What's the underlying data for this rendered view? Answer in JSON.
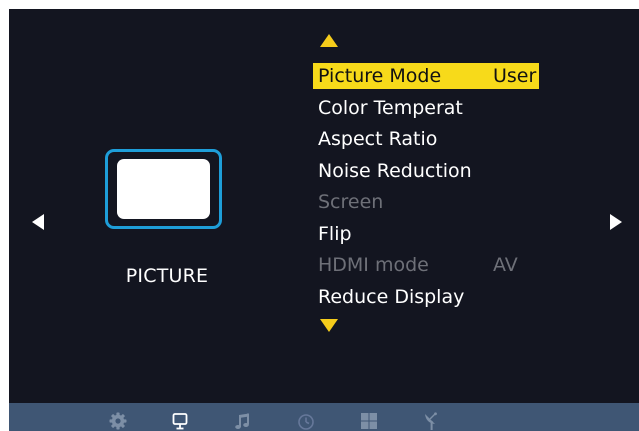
{
  "osd": {
    "category_label": "PICTURE",
    "menu": {
      "items": [
        {
          "label": "Picture Mode",
          "value": "User",
          "state": "selected"
        },
        {
          "label": "Color Temperat",
          "value": "",
          "state": "normal"
        },
        {
          "label": "Aspect Ratio",
          "value": "",
          "state": "normal"
        },
        {
          "label": "Noise Reduction",
          "value": "",
          "state": "normal"
        },
        {
          "label": "Screen",
          "value": "",
          "state": "disabled"
        },
        {
          "label": "Flip",
          "value": "",
          "state": "normal"
        },
        {
          "label": "HDMI mode",
          "value": "AV",
          "state": "disabled"
        },
        {
          "label": "Reduce Display",
          "value": "",
          "state": "normal"
        }
      ]
    },
    "bottom_tabs": [
      {
        "icon": "gear-icon",
        "active": false
      },
      {
        "icon": "monitor-icon",
        "active": true
      },
      {
        "icon": "music-note-icon",
        "active": false
      },
      {
        "icon": "clock-icon",
        "active": false
      },
      {
        "icon": "grid-icon",
        "active": false
      },
      {
        "icon": "satellite-dish-icon",
        "active": false
      }
    ],
    "colors": {
      "background": "#131520",
      "highlight": "#f7da1a",
      "scroll_arrow": "#f5cc1b",
      "frame_border": "#1e9ed9",
      "bottom_bar": "#3f5674",
      "disabled_text": "#6e7078"
    }
  }
}
